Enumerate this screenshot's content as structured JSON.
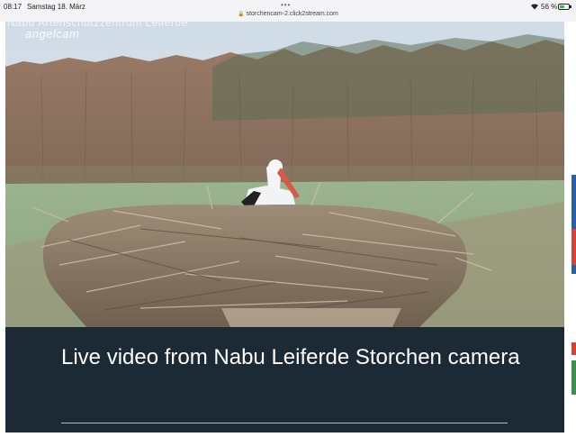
{
  "status_bar": {
    "time": "08:17",
    "date": "Samstag 18. März",
    "url": "storchencam-2.click2stream.com",
    "battery": "56 %",
    "battery_level": 0.56,
    "icons": [
      "wifi-icon",
      "battery-icon",
      "lock-icon",
      "more-dots-icon"
    ]
  },
  "video": {
    "overlay_title": "Nabu Artenschutzzentrum Leiferde",
    "watermark": "angelcam"
  },
  "caption": {
    "title": "Live video from Nabu Leiferde Storchen camera"
  },
  "colors": {
    "caption_bg": "#1c2a36",
    "sky": "#dbe6ee",
    "meadow": "#8fae82"
  }
}
